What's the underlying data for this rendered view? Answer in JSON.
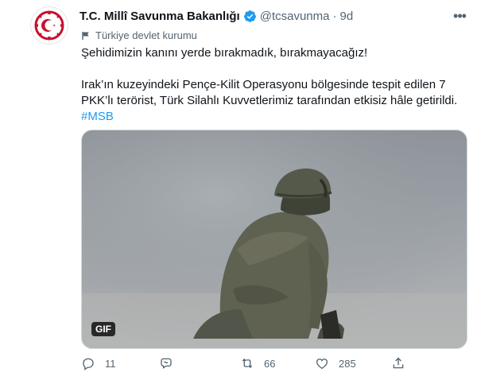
{
  "account": {
    "name": "T.C. Millî Savunma Bakanlığı",
    "handle": "@tcsavunma",
    "separator": "·",
    "time": "9d",
    "label": "Türkiye devlet kurumu"
  },
  "tweet": {
    "line1": "Şehidimizin kanını yerde bırakmadık, bırakmayacağız!",
    "line2": "Irak’ın kuzeyindeki Pençe-Kilit Operasyonu bölgesinde tespit edilen 7 PKK’lı terörist, Türk Silahlı Kuvvetlerimiz tarafından etkisiz hâle getirildi.",
    "hashtag": "#MSB"
  },
  "media": {
    "badge": "GIF"
  },
  "actions": {
    "reply_count": "11",
    "retweet_count": "66",
    "like_count": "285"
  },
  "colors": {
    "link": "#1d9bf0",
    "secondary": "#536471",
    "emblem": "#c8102e"
  },
  "icons": [
    "emblem-icon",
    "verified-badge-icon",
    "more-icon",
    "government-flag-icon",
    "reply-icon",
    "spaces-icon",
    "retweet-icon",
    "like-icon",
    "share-icon"
  ]
}
